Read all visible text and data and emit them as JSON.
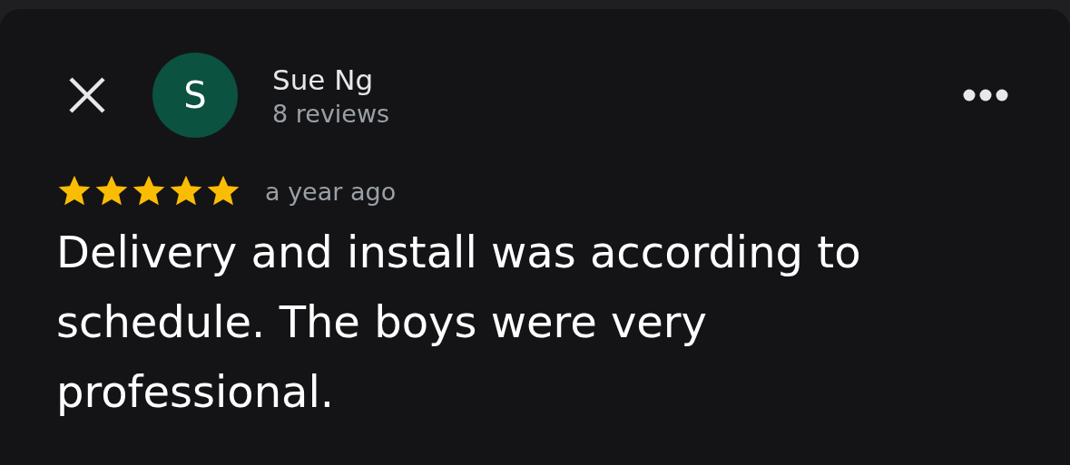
{
  "reviewer": {
    "name": "Sue Ng",
    "initial": "S",
    "reviews": "8 reviews"
  },
  "review": {
    "stars": 5,
    "time": "a year ago",
    "text": "Delivery and install was according to schedule. The boys were very professional."
  }
}
